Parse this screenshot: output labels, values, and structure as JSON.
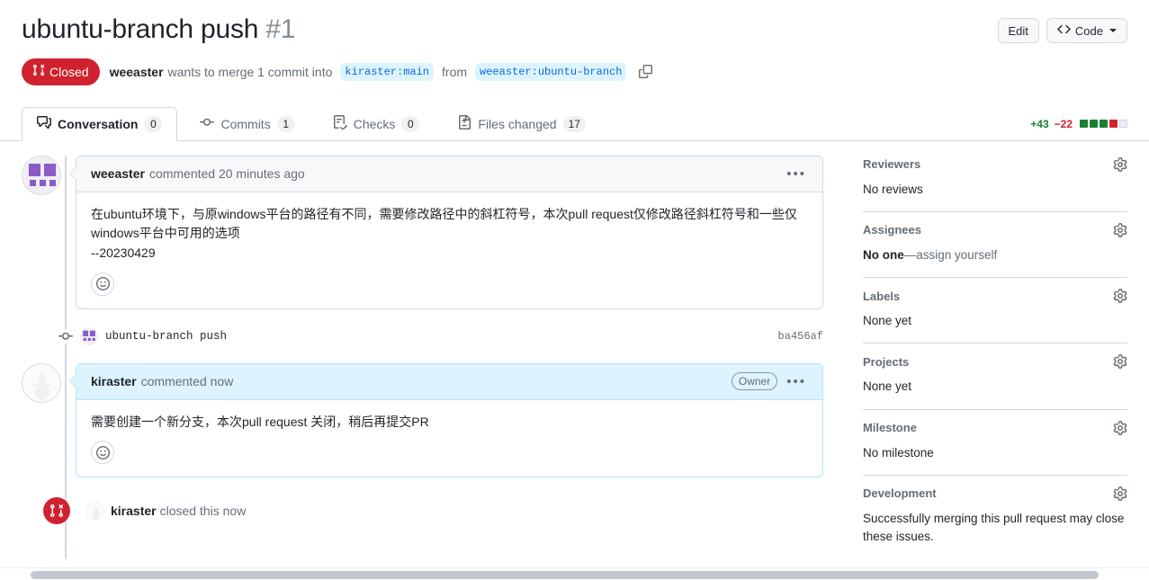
{
  "header": {
    "title": "ubuntu-branch push",
    "number": "#1",
    "edit_label": "Edit",
    "code_label": "Code",
    "state": "Closed",
    "author": "weeaster",
    "merge_text_1": "wants to merge 1 commit into",
    "base_branch": "kiraster:main",
    "merge_text_2": "from",
    "head_branch": "weeaster:ubuntu-branch"
  },
  "tabs": [
    {
      "label": "Conversation",
      "count": "0",
      "icon": "comment-discussion-icon",
      "active": true
    },
    {
      "label": "Commits",
      "count": "1",
      "icon": "git-commit-icon",
      "active": false
    },
    {
      "label": "Checks",
      "count": "0",
      "icon": "checklist-icon",
      "active": false
    },
    {
      "label": "Files changed",
      "count": "17",
      "icon": "file-diff-icon",
      "active": false
    }
  ],
  "diffstat": {
    "additions": "+43",
    "deletions": "−22",
    "blocks": [
      "g",
      "g",
      "g",
      "r",
      "n"
    ],
    "add_color": "#1a7f37",
    "del_color": "#cf222e"
  },
  "timeline": {
    "comments": [
      {
        "author": "weeaster",
        "action": "commented 20 minutes ago",
        "owner_badge": "",
        "is_owner": false,
        "body_lines": [
          "在ubuntu环境下，与原windows平台的路径有不同，需要修改路径中的斜杠符号，本次pull request仅修改路径斜杠符号和一些仅windows平台中可用的选项",
          "--20230429"
        ]
      },
      {
        "author": "kiraster",
        "action": "commented now",
        "owner_badge": "Owner",
        "is_owner": true,
        "body_lines": [
          "需要创建一个新分支，本次pull request 关闭，稍后再提交PR"
        ]
      }
    ],
    "commit": {
      "message": "ubuntu-branch push",
      "sha": "ba456af"
    },
    "closed_event": {
      "user": "kiraster",
      "text": "closed this now"
    }
  },
  "sidebar": [
    {
      "title": "Reviewers",
      "value": "No reviews",
      "value2": "",
      "style": "plain"
    },
    {
      "title": "Assignees",
      "value": "No one",
      "value2": "—assign yourself",
      "style": "assign"
    },
    {
      "title": "Labels",
      "value": "None yet",
      "value2": "",
      "style": "plain"
    },
    {
      "title": "Projects",
      "value": "None yet",
      "value2": "",
      "style": "plain"
    },
    {
      "title": "Milestone",
      "value": "No milestone",
      "value2": "",
      "style": "plain"
    },
    {
      "title": "Development",
      "value": "Successfully merging this pull request may close these issues.",
      "value2": "",
      "style": "plain"
    }
  ]
}
